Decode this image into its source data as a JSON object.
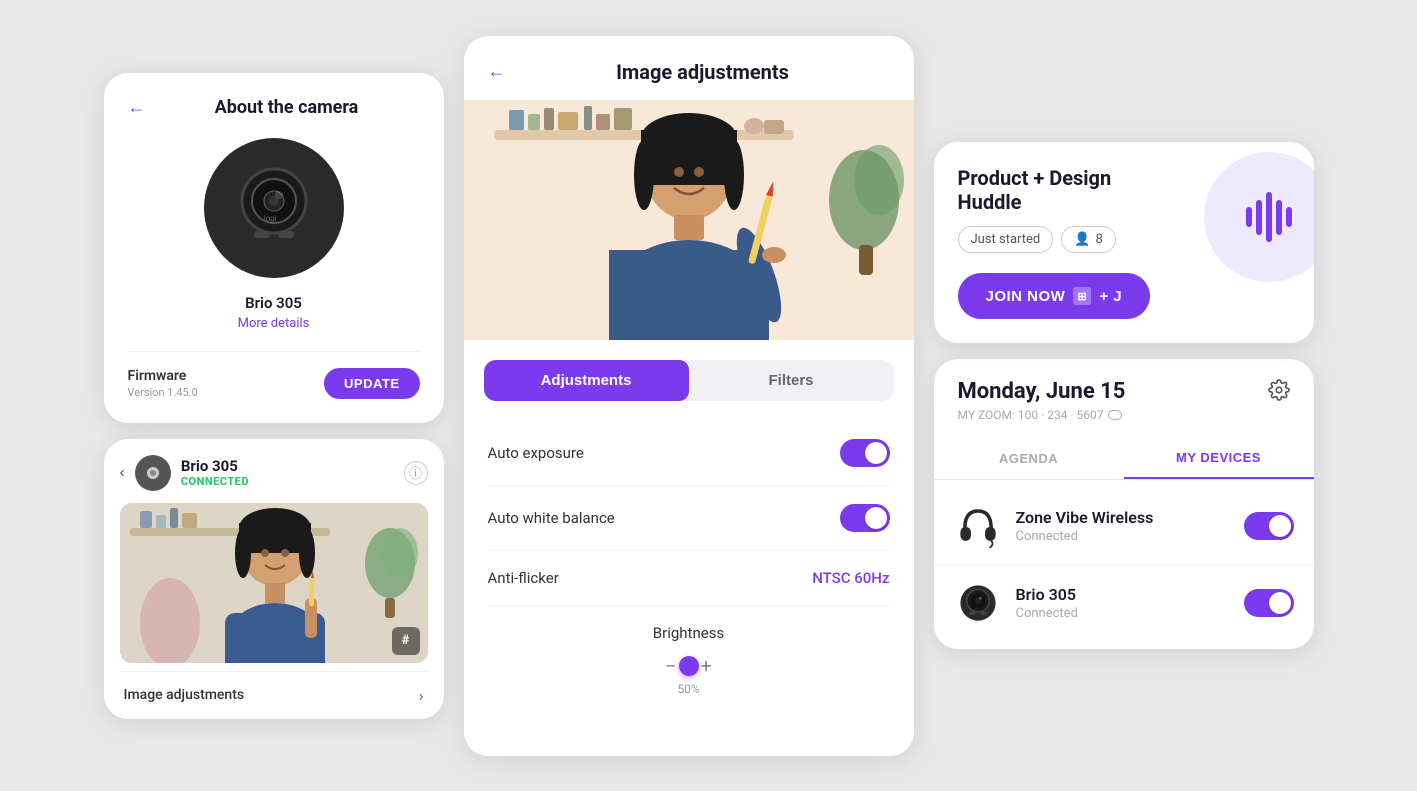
{
  "left": {
    "about_camera": {
      "title": "About the camera",
      "back_label": "←",
      "camera_name": "Brio 305",
      "more_details": "More details",
      "firmware_label": "Firmware",
      "firmware_version": "Version 1.45.0",
      "update_btn": "UPDATE"
    },
    "camera_preview": {
      "back_label": "‹",
      "camera_name": "Brio 305",
      "connected_status": "CONNECTED",
      "hashtag": "#",
      "image_adjustments_label": "Image adjustments",
      "chevron_right": "›"
    }
  },
  "middle": {
    "title": "Image adjustments",
    "back_label": "←",
    "tabs": [
      {
        "id": "adjustments",
        "label": "Adjustments",
        "active": true
      },
      {
        "id": "filters",
        "label": "Filters",
        "active": false
      }
    ],
    "settings": [
      {
        "id": "auto_exposure",
        "label": "Auto exposure",
        "type": "toggle",
        "value": true
      },
      {
        "id": "auto_white_balance",
        "label": "Auto white balance",
        "type": "toggle",
        "value": true
      },
      {
        "id": "anti_flicker",
        "label": "Anti-flicker",
        "type": "select",
        "value": "NTSC 60Hz"
      },
      {
        "id": "brightness",
        "label": "Brightness",
        "type": "slider",
        "pct": "50%",
        "value": 50
      }
    ]
  },
  "right": {
    "huddle": {
      "close_btn": "×",
      "title": "Product + Design Huddle",
      "status_badge": "Just started",
      "people_count": "8",
      "join_btn_label": "JOIN NOW",
      "join_shortcut": "⊞ + J"
    },
    "calendar": {
      "date": "Monday, June 15",
      "zoom_label": "MY ZOOM: 100 · 234 · 5607",
      "tabs": [
        {
          "id": "agenda",
          "label": "AGENDA",
          "active": false
        },
        {
          "id": "my_devices",
          "label": "MY DEVICES",
          "active": true
        }
      ],
      "devices": [
        {
          "id": "zone_vibe",
          "name": "Zone Vibe Wireless",
          "status": "Connected",
          "toggle": true
        },
        {
          "id": "brio305",
          "name": "Brio 305",
          "status": "Connected",
          "toggle": true
        }
      ]
    }
  }
}
